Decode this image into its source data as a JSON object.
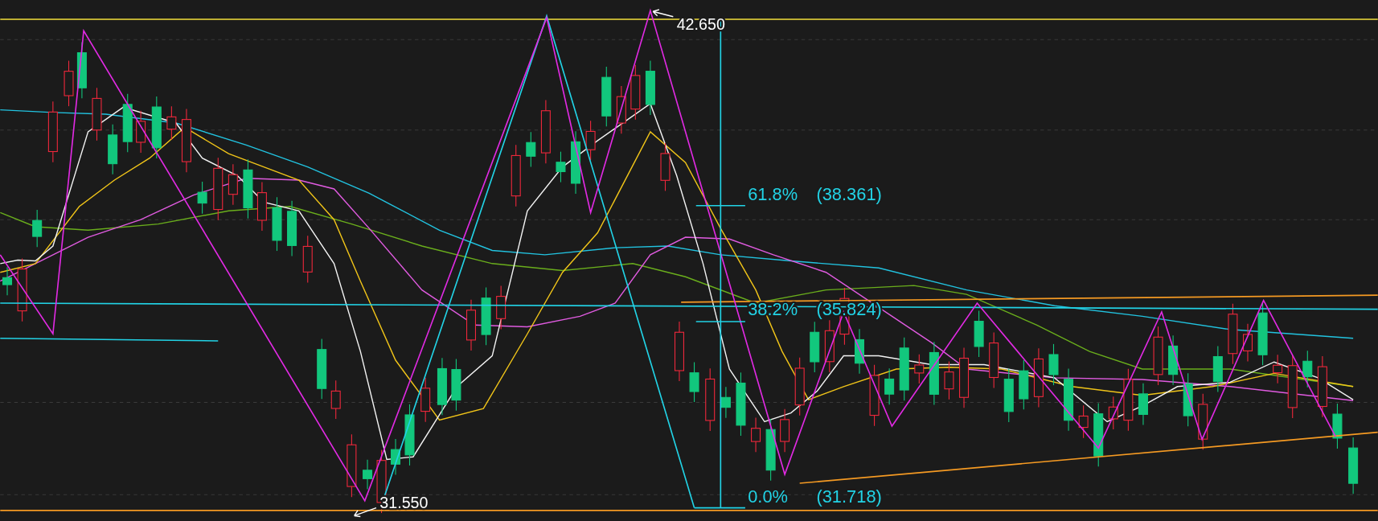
{
  "chart": {
    "high_label": "42.650",
    "low_label": "31.550",
    "fib_levels": [
      {
        "percent": "61.8%",
        "price": "(38.361)"
      },
      {
        "percent": "38.2%",
        "price": "(35.824)"
      },
      {
        "percent": "0.0%",
        "price": "(31.718)"
      }
    ]
  }
}
